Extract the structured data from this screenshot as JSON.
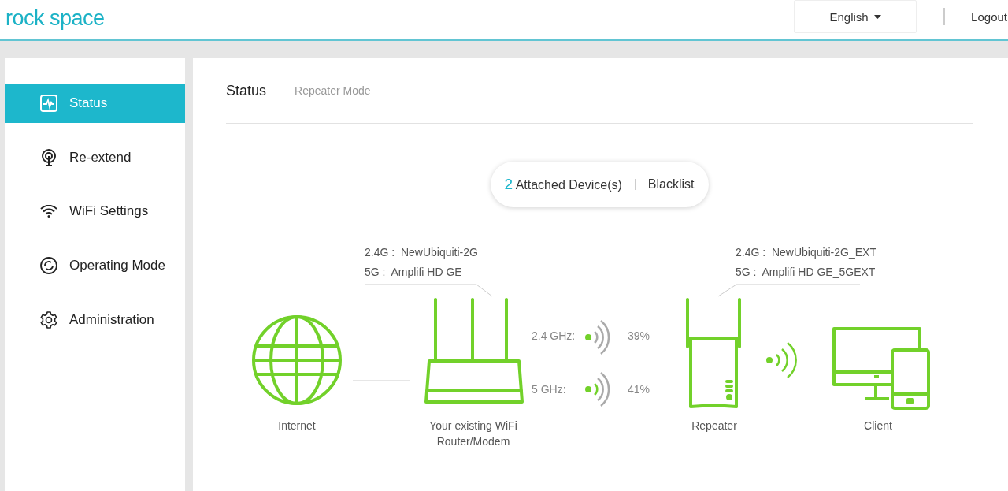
{
  "header": {
    "logo": "rock space",
    "language": "English",
    "logout": "Logout"
  },
  "sidebar": {
    "items": [
      {
        "label": "Status",
        "kind": "status",
        "selected": true
      },
      {
        "label": "Re-extend",
        "kind": "reextend",
        "selected": false
      },
      {
        "label": "WiFi Settings",
        "kind": "wifi",
        "selected": false
      },
      {
        "label": "Operating Mode",
        "kind": "mode",
        "selected": false
      },
      {
        "label": "Administration",
        "kind": "admin",
        "selected": false
      }
    ]
  },
  "page": {
    "title": "Status",
    "mode": "Repeater Mode"
  },
  "devices": {
    "count": "2",
    "label": "Attached Device(s)",
    "blacklist": "Blacklist"
  },
  "diagram": {
    "internet": {
      "label": "Internet"
    },
    "router": {
      "label_lines": [
        "Your existing WiFi",
        "Router/Modem"
      ],
      "ssids": [
        {
          "band": "2.4G :",
          "name": "NewUbiquiti-2G"
        },
        {
          "band": "5G :",
          "name": "Amplifi HD GE"
        }
      ]
    },
    "signals": [
      {
        "band": "2.4 GHz:",
        "arcs_on": [
          false,
          false,
          false
        ],
        "reading": "39%"
      },
      {
        "band": "5 GHz:",
        "arcs_on": [
          true,
          false,
          false
        ],
        "reading": "41%"
      }
    ],
    "repeater": {
      "label": "Repeater",
      "ssids": [
        {
          "band": "2.4G :",
          "name": "NewUbiquiti-2G_EXT"
        },
        {
          "band": "5G :",
          "name": "Amplifi HD GE_5GEXT"
        }
      ]
    },
    "client": {
      "label": "Client"
    }
  }
}
